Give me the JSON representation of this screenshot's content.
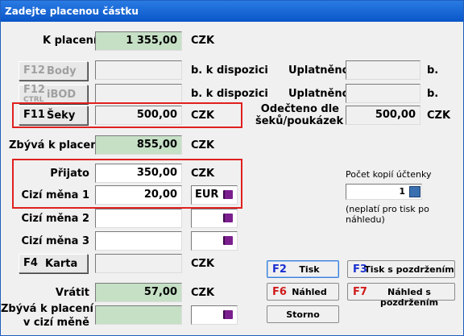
{
  "window": {
    "title": "Zadejte placenou částku"
  },
  "currency": "CZK",
  "k_placeni": {
    "label": "K placení",
    "value": "1 355,00"
  },
  "body": {
    "key": "F12",
    "label": "Body",
    "suffix": "b. k dispozici",
    "used_label": "Uplatněno",
    "used_suffix": "b."
  },
  "ibod": {
    "key": "F12",
    "key_sub": "CTRL",
    "label": "iBOD",
    "suffix": "b. k dispozici",
    "used_label": "Uplatněno",
    "used_suffix": "b."
  },
  "seky": {
    "key": "F11",
    "label": "Šeky",
    "value": "500,00"
  },
  "odecteno": {
    "label_line1": "Odečteno dle",
    "label_line2": "šeků/poukázek",
    "value": "500,00"
  },
  "zbyva": {
    "label": "Zbývá k placení",
    "value": "855,00"
  },
  "prijato": {
    "label": "Přijato",
    "value": "350,00"
  },
  "cizi1": {
    "label": "Cizí měna 1",
    "value": "20,00",
    "currency": "EUR"
  },
  "cizi2": {
    "label": "Cizí měna 2"
  },
  "cizi3": {
    "label": "Cizí měna 3"
  },
  "karta": {
    "key": "F4",
    "label": "Karta"
  },
  "vratit": {
    "label": "Vrátit",
    "value": "57,00"
  },
  "zbyva_cizi": {
    "label_line1": "Zbývá k placení",
    "label_line2": "v cizí měně"
  },
  "kopie": {
    "label": "Počet kopií účtenky",
    "value": "1",
    "note": "(neplatí pro tisk po náhledu)"
  },
  "buttons": {
    "tisk": {
      "key": "F2",
      "label": "Tisk"
    },
    "tisk_pozdrzenim": {
      "key": "F3",
      "label": "Tisk s pozdržením"
    },
    "nahled": {
      "key": "F6",
      "label": "Náhled"
    },
    "nahled_pozdrzenim": {
      "key": "F7",
      "label": "Náhled s pozdržením"
    },
    "storno": {
      "label": "Storno"
    }
  },
  "colors": {
    "title_bar": "#0a56c8",
    "highlight_box": "#e02020",
    "green_field": "#c6e0c6",
    "key_blue": "#1a2fd0",
    "key_red": "#d01a1a"
  }
}
